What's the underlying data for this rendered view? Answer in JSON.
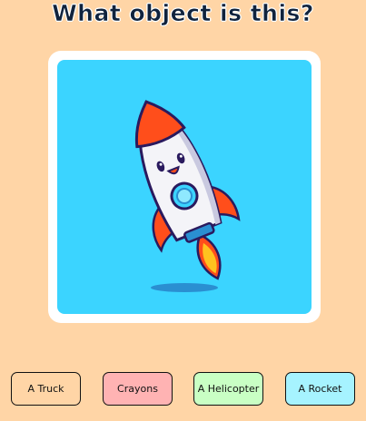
{
  "question": "What object is this?",
  "image": {
    "subject": "rocket-illustration",
    "background_color": "#3bd4ff"
  },
  "answers": [
    {
      "label": "A Truck",
      "color": "#ffd5a6"
    },
    {
      "label": "Crayons",
      "color": "#ffb3b3"
    },
    {
      "label": "A Helicopter",
      "color": "#c9ffc4"
    },
    {
      "label": "A Rocket",
      "color": "#a6f3ff"
    }
  ]
}
